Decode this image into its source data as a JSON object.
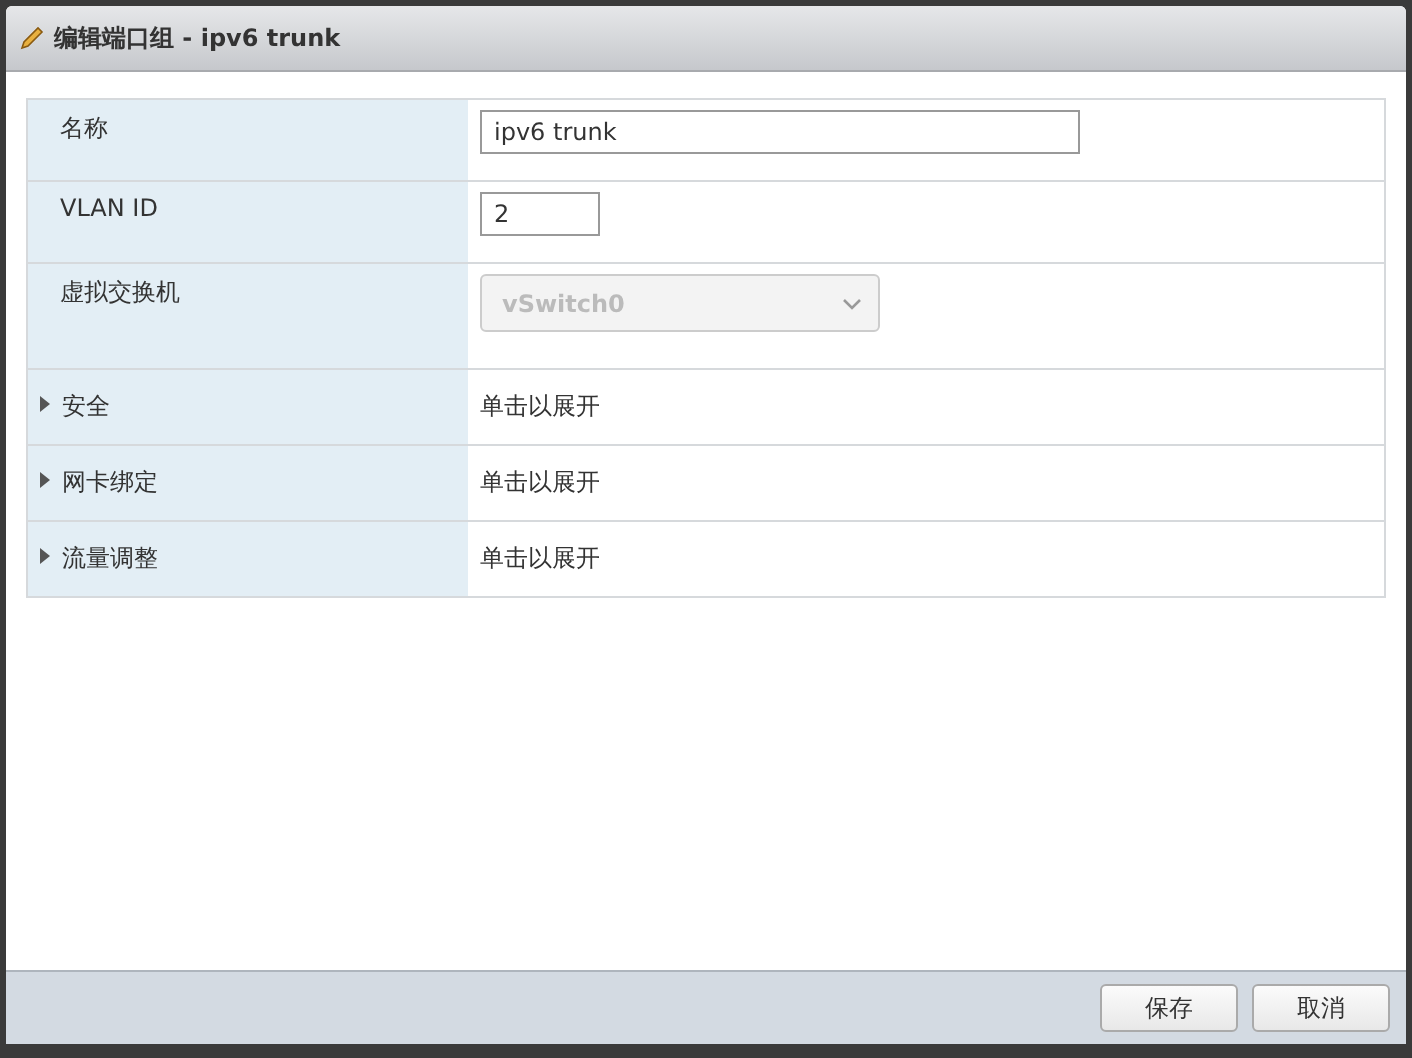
{
  "window": {
    "title": "编辑端口组 - ipv6 trunk"
  },
  "fields": [
    {
      "kind": "text",
      "label": "名称",
      "value": "ipv6 trunk"
    },
    {
      "kind": "number",
      "label": "VLAN ID",
      "value": "2"
    },
    {
      "kind": "select",
      "label": "虚拟交换机",
      "value": "vSwitch0",
      "disabled": true
    },
    {
      "kind": "expandable",
      "label": "安全",
      "value": "单击以展开",
      "expanded": false
    },
    {
      "kind": "expandable",
      "label": "网卡绑定",
      "value": "单击以展开",
      "expanded": false
    },
    {
      "kind": "expandable",
      "label": "流量调整",
      "value": "单击以展开",
      "expanded": false
    }
  ],
  "buttons": [
    "保存",
    "取消"
  ]
}
